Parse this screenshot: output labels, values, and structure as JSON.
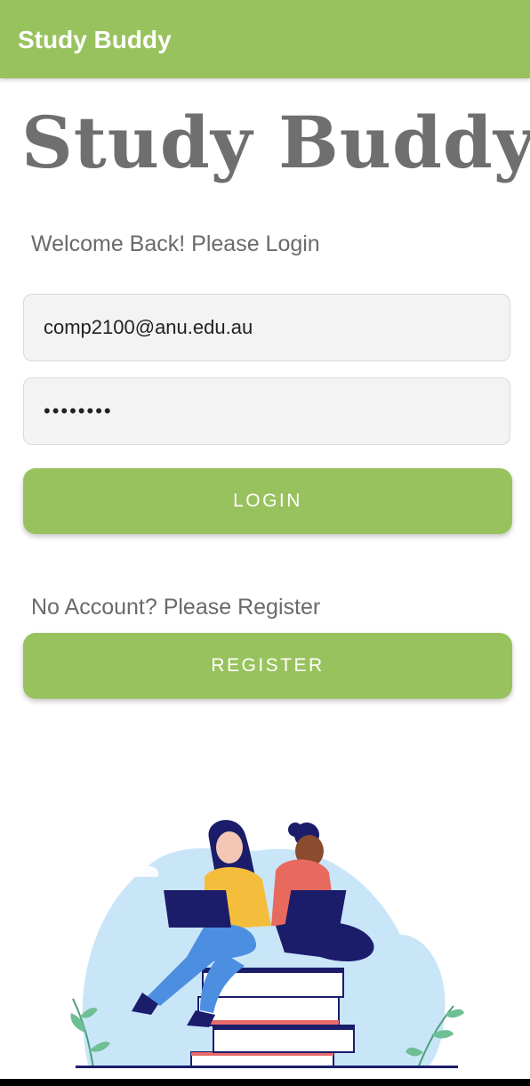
{
  "app_bar": {
    "title": "Study Buddy"
  },
  "header": {
    "title": "Study Buddy"
  },
  "login": {
    "prompt": "Welcome Back! Please Login",
    "email_value": "comp2100@anu.edu.au",
    "password_value": "••••••••",
    "login_label": "LOGIN"
  },
  "register": {
    "prompt": "No Account? Please Register",
    "register_label": "REGISTER"
  },
  "colors": {
    "accent": "#98c25d",
    "title_gray": "#6f6f6f",
    "field_bg": "#f3f3f3"
  },
  "illustration": {
    "icon": "students-studying-on-books-illustration"
  }
}
